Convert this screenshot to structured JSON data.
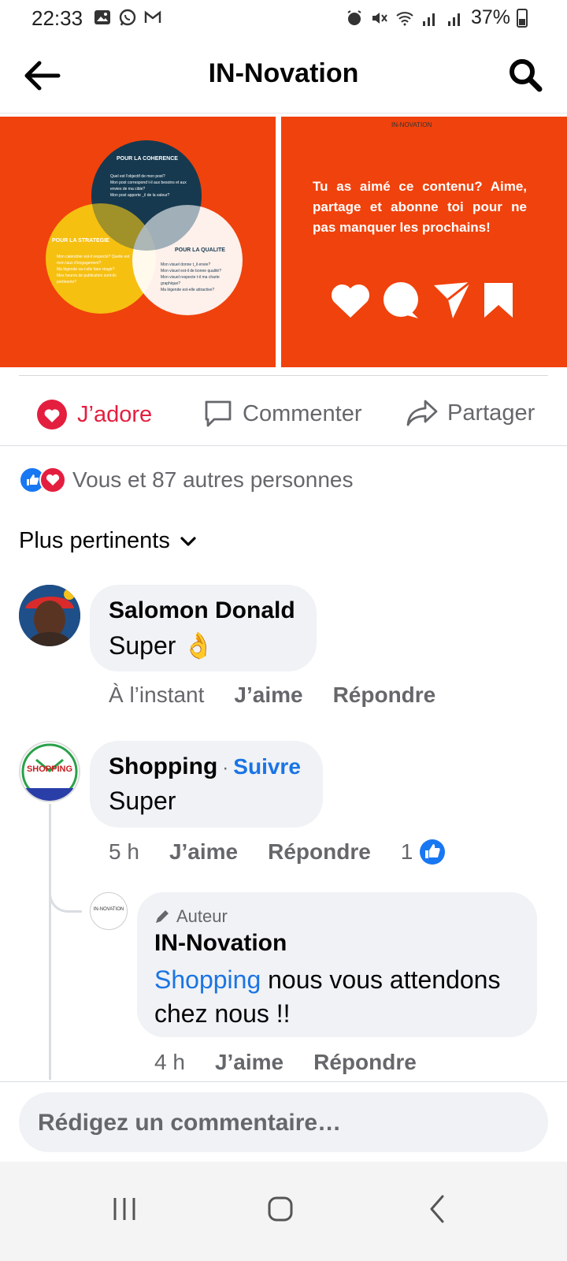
{
  "status": {
    "time": "22:33",
    "battery": "37%"
  },
  "header": {
    "title": "IN-Novation"
  },
  "images": {
    "venn": {
      "top": "POUR LA COHERENCE",
      "left": "POUR LA STRATEGIE",
      "right": "POUR LA QUALITE",
      "top_lines": [
        "Quel est l'objectif de mon post?",
        "Mon post correspond t-il aux besoins et aux envies de ma cible?",
        "Mon post apporte _il de la valeur?"
      ],
      "left_lines": [
        "Mon calendrier est-il respecté? Quelle est mon taux d'engagement?",
        "Ma légende va-t-elle faire réagir?",
        "Mes heures de publication sont-ils pertinents?"
      ],
      "right_lines": [
        "Mon visuel donne t_il envie?",
        "Mon visuel est-il de bonne qualité?",
        "Mon visuel respecte t-il ma charte graphique?",
        "Ma légende est-elle attractive?"
      ]
    },
    "promo": {
      "brand": "IN-NOVATION",
      "text": "Tu as aimé ce contenu? Aime, partage et abonne toi pour ne pas manquer les prochains!"
    }
  },
  "actions": {
    "love": "J’adore",
    "comment": "Commenter",
    "share": "Partager"
  },
  "reactions": {
    "summary": "Vous et 87 autres personnes"
  },
  "sort": {
    "label": "Plus pertinents"
  },
  "comments": [
    {
      "author": "Salomon Donald",
      "text": "Super 👌",
      "time": "À l’instant",
      "like": "J’aime",
      "reply": "Répondre"
    },
    {
      "author": "Shopping",
      "follow": "Suivre",
      "avatar_label": "SHOPPING",
      "text": "Super",
      "time": "5 h",
      "like": "J’aime",
      "reply": "Répondre",
      "like_count": "1"
    }
  ],
  "reply": {
    "badge": "Auteur",
    "author": "IN-Novation",
    "avatar_label": "IN-NOVATION",
    "mention": "Shopping",
    "text": " nous vous attendons chez nous !!",
    "time": "4 h",
    "like": "J’aime",
    "reply": "Répondre"
  },
  "composer": {
    "placeholder": "Rédigez un commentaire…"
  },
  "colors": {
    "accent_red": "#e41e3f",
    "image_bg": "#f0420c",
    "link_blue": "#1b74e4",
    "like_blue": "#1877f2"
  }
}
